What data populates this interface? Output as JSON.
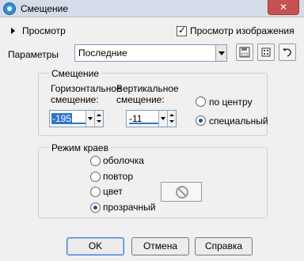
{
  "window": {
    "title": "Смещение"
  },
  "preview": {
    "toggle_label": "Просмотр",
    "show_preview_label": "Просмотр изображения",
    "show_preview_checked": true
  },
  "params": {
    "label": "Параметры",
    "preset_value": "Последние"
  },
  "offset_group": {
    "title": "Смещение",
    "horizontal_label_line1": "Горизонтальное",
    "horizontal_label_line2": "смещение:",
    "vertical_label_line1": "Вертикальное",
    "vertical_label_line2": "смещение:",
    "horizontal_value": "-195",
    "vertical_value": "-11",
    "center_label": "по центру",
    "custom_label": "специальный",
    "selected": "custom"
  },
  "edge_group": {
    "title": "Режим краев",
    "options": [
      "оболочка",
      "повтор",
      "цвет",
      "прозрачный"
    ],
    "selected": "прозрачный"
  },
  "buttons": {
    "ok": "OK",
    "cancel": "Отмена",
    "help": "Справка"
  },
  "icons": {
    "save": "save-icon",
    "random": "dice-icon",
    "reset": "undo-icon",
    "no_color": "no-color-icon"
  }
}
